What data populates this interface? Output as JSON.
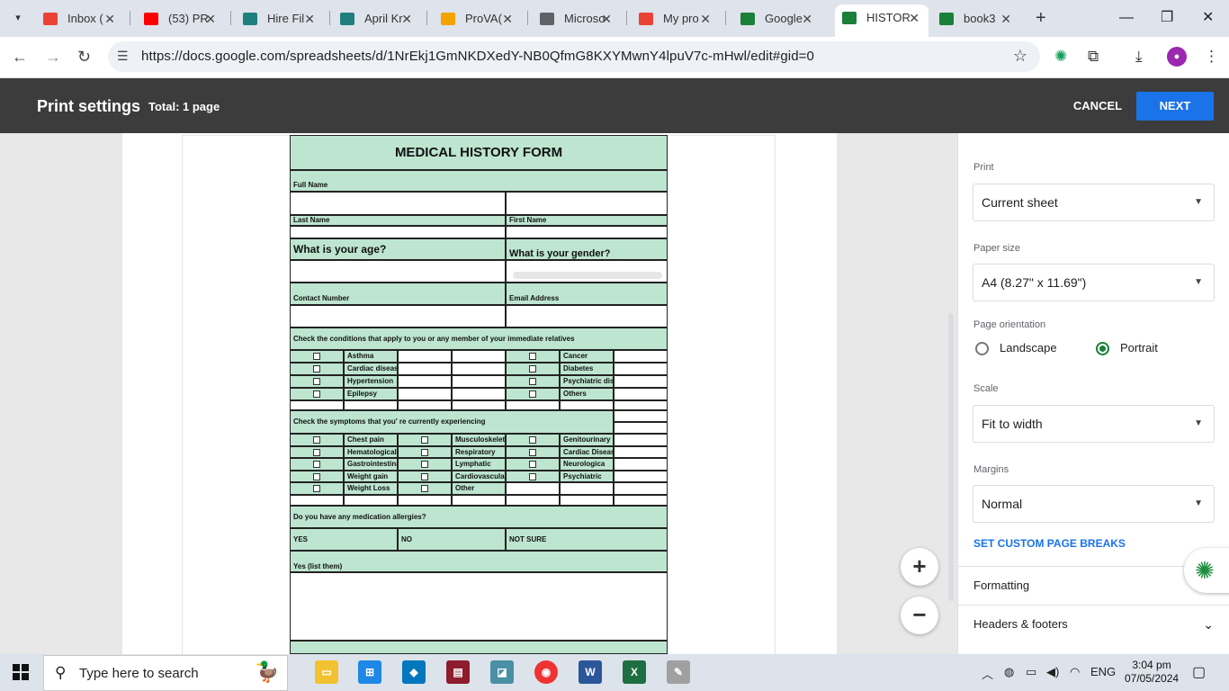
{
  "browser": {
    "tabs": [
      {
        "title": "Inbox (",
        "fav": "gmail-icon",
        "color": "#ea4335"
      },
      {
        "title": "(53) PR",
        "fav": "youtube-icon",
        "color": "#ff0000"
      },
      {
        "title": "Hire Fil",
        "fav": "freelance-icon",
        "color": "#1f7f7f"
      },
      {
        "title": "April Kr",
        "fav": "freelance-icon",
        "color": "#1f7f7f"
      },
      {
        "title": "ProVA(",
        "fav": "prova-icon",
        "color": "#f4a300"
      },
      {
        "title": "Microso",
        "fav": "globe-icon",
        "color": "#5f6368"
      },
      {
        "title": "My pro",
        "fav": "gmail-icon",
        "color": "#ea4335"
      },
      {
        "title": "Google",
        "fav": "sheets-icon",
        "color": "#188038"
      },
      {
        "title": "HISTOR",
        "fav": "sheets-icon",
        "color": "#188038"
      },
      {
        "title": "book3",
        "fav": "sheets-icon",
        "color": "#188038"
      }
    ],
    "url": "https://docs.google.com/spreadsheets/d/1NrEkj1GmNKDXedY-NB0QfmG8KXYMwnY4lpuV7c-mHwl/edit#gid=0"
  },
  "print_header": {
    "title": "Print settings",
    "total": "Total: 1 page",
    "cancel": "CANCEL",
    "next": "NEXT"
  },
  "form": {
    "title": "MEDICAL HISTORY FORM",
    "full_name": "Full Name",
    "last_name": "Last Name",
    "first_name": "First Name",
    "age_q": "What is your age?",
    "gender_q": "What is your gender?",
    "contact": "Contact Number",
    "email": "Email Address",
    "conditions_q": "Check the conditions that apply to you or any member of your immediate relatives",
    "conditions_left": [
      "Asthma",
      "Cardiac disease",
      "Hypertension",
      "Epilepsy"
    ],
    "conditions_right": [
      "Cancer",
      "Diabetes",
      "Psychiatric disorder",
      "Others"
    ],
    "symptoms_q": "Check the symptoms that you' re currently experiencing",
    "symptoms_a": [
      "Chest pain",
      "Hematological",
      "Gastrointestina",
      "Weight gain",
      "Weight Loss"
    ],
    "symptoms_b": [
      "Musculoskelet",
      "Respiratory",
      "Lymphatic",
      "Cardiovascular",
      "Other"
    ],
    "symptoms_c": [
      "Genitourinary",
      "Cardiac Disease",
      "Neurologica",
      "Psychiatric"
    ],
    "allergy_q": "Do you have any medication allergies?",
    "yes": "YES",
    "no": "NO",
    "not_sure": "NOT SURE",
    "yes_list": "Yes (list them)"
  },
  "settings": {
    "print_label": "Print",
    "print_value": "Current sheet",
    "paper_label": "Paper size",
    "paper_value": "A4 (8.27\" x 11.69\")",
    "orient_label": "Page orientation",
    "landscape": "Landscape",
    "portrait": "Portrait",
    "orientation_selected": "Portrait",
    "scale_label": "Scale",
    "scale_value": "Fit to width",
    "margins_label": "Margins",
    "margins_value": "Normal",
    "custom_breaks": "SET CUSTOM PAGE BREAKS",
    "formatting": "Formatting",
    "headers_footers": "Headers & footers"
  },
  "taskbar": {
    "search_placeholder": "Type here to search",
    "lang": "ENG",
    "time": "3:04 pm",
    "date": "07/05/2024"
  },
  "colors": {
    "form_fill": "#bde5d0",
    "accent": "#1a73e8",
    "print_bar": "#3c3c3c"
  }
}
